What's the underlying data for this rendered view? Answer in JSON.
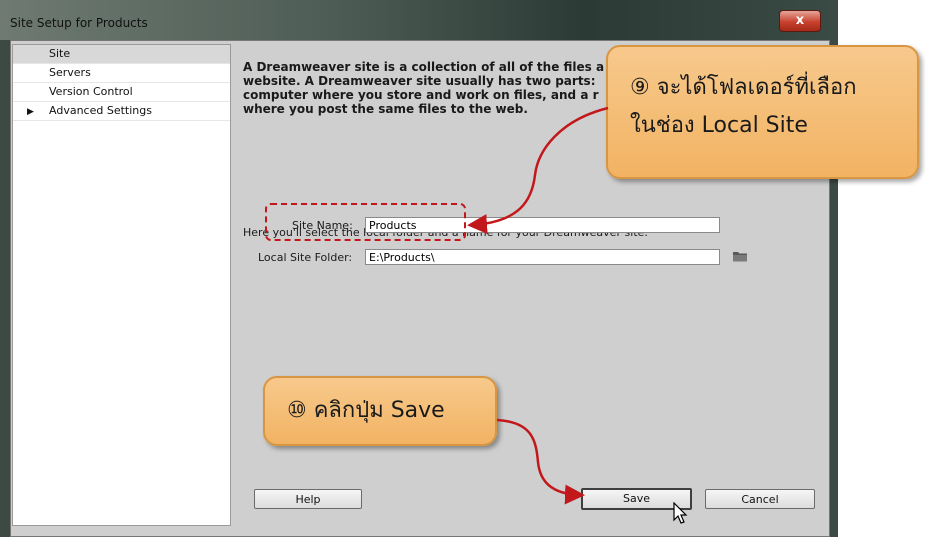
{
  "window": {
    "title": "Site Setup for Products",
    "close_label": "x"
  },
  "sidebar": {
    "items": [
      {
        "label": "Site",
        "selected": true,
        "expandable": false
      },
      {
        "label": "Servers",
        "selected": false,
        "expandable": false
      },
      {
        "label": "Version Control",
        "selected": false,
        "expandable": false
      },
      {
        "label": "Advanced Settings",
        "selected": false,
        "expandable": true
      }
    ]
  },
  "main": {
    "description_lines": [
      "A Dreamweaver site is a collection of all of the files a",
      "website. A Dreamweaver site usually has two parts:",
      "computer where you store and work on files, and a r",
      "where you post the same files to the web."
    ],
    "intro": "Here you'll select the local folder and a name for your Dreamweaver site.",
    "site_name_label": "Site Name:",
    "site_name_value": "Products",
    "local_folder_label": "Local Site Folder:",
    "local_folder_value": "E:\\Products\\"
  },
  "buttons": {
    "help": "Help",
    "save": "Save",
    "cancel": "Cancel"
  },
  "callouts": {
    "step9_line1": "⑨ จะได้โฟลเดอร์ที่เลือก",
    "step9_line2": "ในช่อง Local Site",
    "step10": "⑩ คลิกปุ่ม Save"
  },
  "colors": {
    "callout_fill": "#f2b363",
    "annotation_red": "#c2181c",
    "frame_dark": "#3d4a44"
  },
  "icons": {
    "folder": "folder-icon",
    "cursor": "mouse-pointer-icon",
    "expand": "triangle-right-icon"
  }
}
